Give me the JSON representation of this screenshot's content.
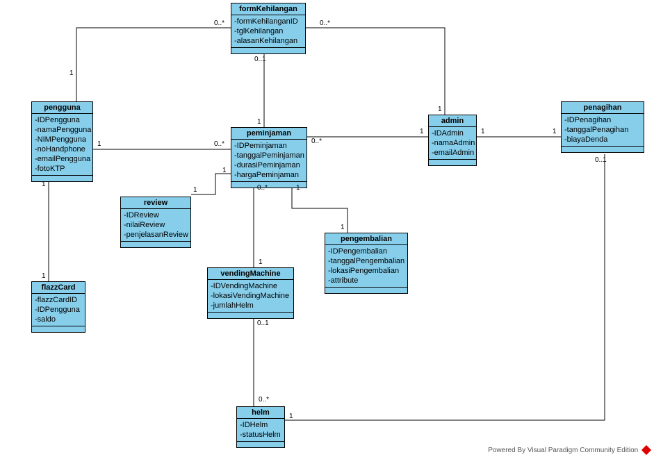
{
  "classes": {
    "pengguna": {
      "title": "pengguna",
      "attrs": [
        "-IDPengguna",
        "-namaPengguna",
        "-NIMPengguna",
        "-noHandphone",
        "-emailPengguna",
        "-fotoKTP"
      ]
    },
    "formKehilangan": {
      "title": "formKehilangan",
      "attrs": [
        "-formKehilanganID",
        "-tglKehilangan",
        "-alasanKehilangan"
      ]
    },
    "admin": {
      "title": "admin",
      "attrs": [
        "-IDAdmin",
        "-namaAdmin",
        "-emailAdmin"
      ]
    },
    "penagihan": {
      "title": "penagihan",
      "attrs": [
        "-IDPenagihan",
        "-tanggalPenagihan",
        "-biayaDenda"
      ]
    },
    "peminjaman": {
      "title": "peminjaman",
      "attrs": [
        "-IDPeminjaman",
        "-tanggalPeminjaman",
        "-durasiPeminjaman",
        "-hargaPeminjaman"
      ]
    },
    "review": {
      "title": "review",
      "attrs": [
        "-IDReview",
        "-nilaiReview",
        "-penjelasanReview"
      ]
    },
    "flazzCard": {
      "title": "flazzCard",
      "attrs": [
        "-flazzCardID",
        "-IDPengguna",
        "-saldo"
      ]
    },
    "vendingMachine": {
      "title": "vendingMachine",
      "attrs": [
        "-IDVendingMachine",
        "-lokasiVendingMachine",
        "-jumlahHelm"
      ]
    },
    "pengembalian": {
      "title": "pengembalian",
      "attrs": [
        "-IDPengembalian",
        "-tanggalPengembalian",
        "-lokasiPengembalian",
        "-attribute"
      ]
    },
    "helm": {
      "title": "helm",
      "attrs": [
        "-IDHelm",
        "-statusHelm"
      ]
    }
  },
  "multiplicities": {
    "pengguna_form_left": "1",
    "pengguna_form_right": "0..*",
    "pengguna_peminjaman_left": "1",
    "pengguna_peminjaman_right": "0..*",
    "pengguna_flazz_top": "1",
    "pengguna_flazz_bottom": "1",
    "form_peminjaman_top": "0..1",
    "form_peminjaman_bottom": "1",
    "form_admin_left": "0..*",
    "form_admin_right": "1",
    "peminjaman_admin_left": "0..*",
    "peminjaman_admin_right": "1",
    "admin_penagihan_left": "1",
    "admin_penagihan_right": "1",
    "peminjaman_review_left": "1",
    "peminjaman_review_right": "1",
    "peminjaman_vending_top": "0..*",
    "peminjaman_vending_bottom": "1",
    "peminjaman_pengembalian_left": "1",
    "peminjaman_pengembalian_right": "1",
    "vending_helm_top": "0..1",
    "vending_helm_bottom": "0..*",
    "helm_penagihan_left": "1",
    "helm_penagihan_right": "0..1"
  },
  "footer": "Powered By Visual Paradigm Community Edition"
}
